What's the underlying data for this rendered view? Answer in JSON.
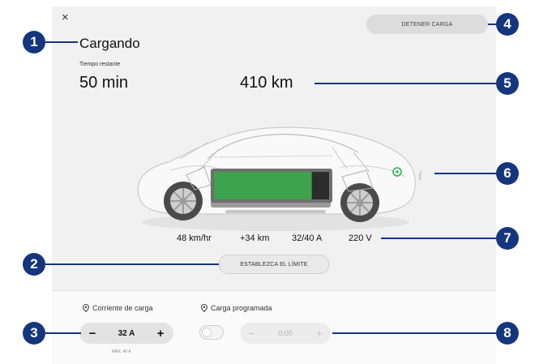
{
  "screen": {
    "close_icon": "×",
    "status_title": "Cargando",
    "time_remaining_label": "Tiempo restante",
    "time_remaining_value": "50 min",
    "range": "410 km",
    "stop_charging_label": "DETENER CARGA",
    "set_limit_label": "ESTABLEZCA EL LÍMITE",
    "charge_fraction": 0.85,
    "stats": {
      "rate": "48 km/hr",
      "added": "+34 km",
      "current": "32/40 A",
      "voltage": "220 V"
    }
  },
  "bottom": {
    "current_label": "Corriente de carga",
    "current_value": "32 A",
    "current_minus": "−",
    "current_plus": "+",
    "max_label": "MÁX. 40 A",
    "scheduled_label": "Carga programada",
    "scheduled_enabled": false,
    "scheduled_time": "0:00",
    "scheduled_minus": "−",
    "scheduled_plus": "+"
  },
  "callouts": [
    "1",
    "2",
    "3",
    "4",
    "5",
    "6",
    "7",
    "8"
  ],
  "icons": {
    "charge_port": "charge-port-icon",
    "lock": "lock-icon",
    "location_pin": "location-pin-icon"
  },
  "colors": {
    "callout": "#15357e",
    "battery_green": "#3fa34d",
    "charge_port_green": "#2fb34a"
  }
}
